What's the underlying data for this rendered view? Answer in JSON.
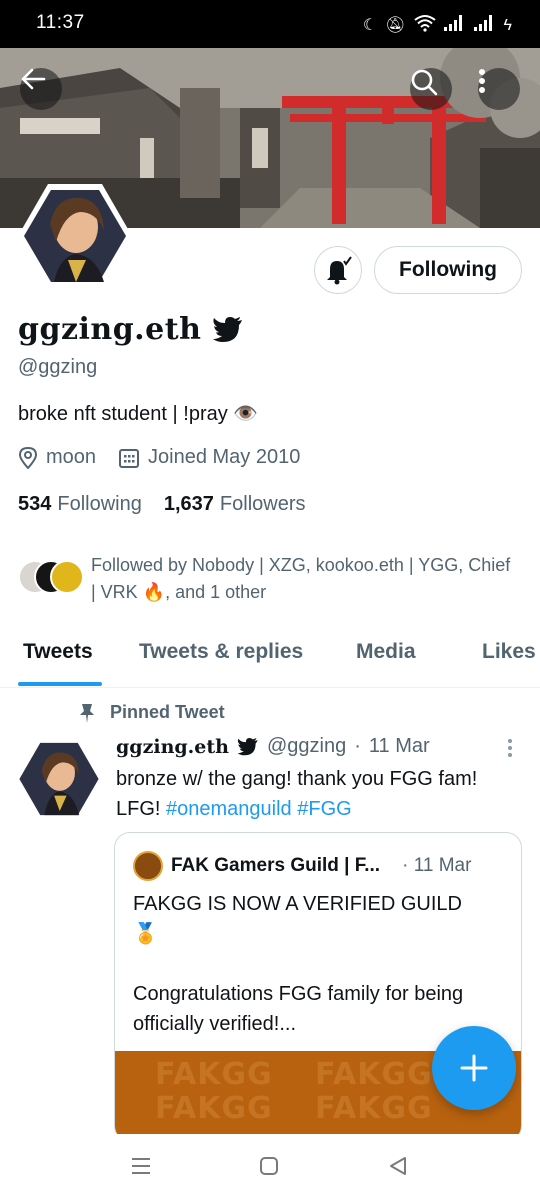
{
  "status_bar": {
    "time": "11:37"
  },
  "profile": {
    "display_name": "ggzing.eth",
    "handle": "@ggzing",
    "bio": "broke nft student | !pray 👁️",
    "location": "moon",
    "joined": "Joined May 2010",
    "following_count": "534",
    "following_label": "Following",
    "followers_count": "1,637",
    "followers_label": "Followers",
    "followed_by": "Followed by Nobody | XZG, kookoo.eth | YGG, Chief | VRK 🔥, and 1 other",
    "follow_button_label": "Following"
  },
  "tabs": [
    "Tweets",
    "Tweets & replies",
    "Media",
    "Likes"
  ],
  "active_tab": "Tweets",
  "tweet": {
    "pinned_label": "Pinned Tweet",
    "author_name": "ggzing.eth",
    "author_handle": "@ggzing",
    "separator": "·",
    "date": "11 Mar",
    "text_plain": "bronze w/ the gang! thank you FGG fam! LFG! ",
    "hashtags": "#onemanguild #FGG",
    "quote": {
      "author_name": "FAK Gamers Guild | F...",
      "date": "· 11 Mar",
      "line1": "FAKGG IS NOW A VERIFIED GUILD",
      "medal": "🏅",
      "line2": "Congratulations FGG family for being officially verified!...",
      "image_watermark": "FAKGG"
    }
  },
  "colors": {
    "accent": "#1d9bf0",
    "text": "#0f1419",
    "secondary": "#536471",
    "torii": "#d22b2b"
  },
  "icons": [
    "back-arrow-icon",
    "search-icon",
    "more-vertical-icon",
    "bell-icon",
    "verified-bird-icon",
    "location-icon",
    "calendar-icon",
    "pin-icon",
    "compose-plus-icon",
    "menu-icon",
    "home-square-icon",
    "back-triangle-icon"
  ]
}
